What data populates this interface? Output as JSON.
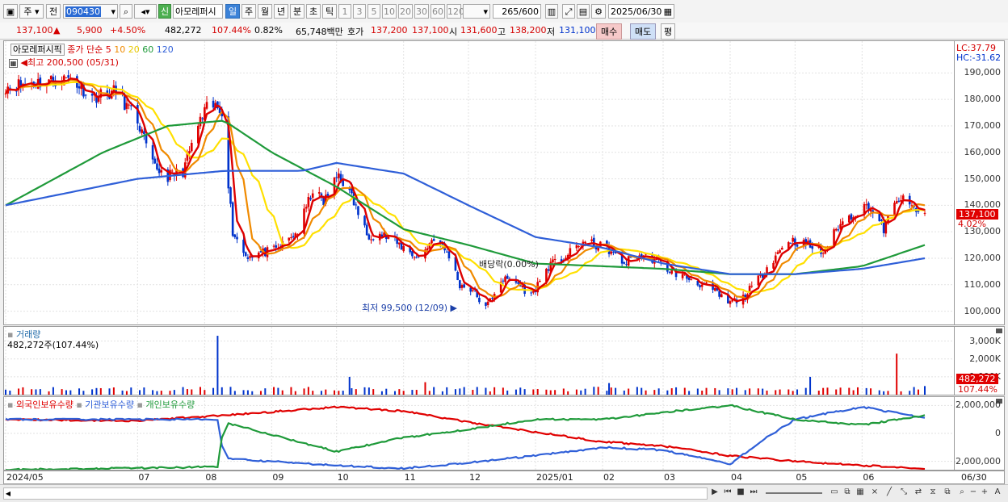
{
  "toolbar": {
    "type_label": "주",
    "prev_label": "전",
    "code": "090430",
    "sin_label": "신",
    "stock_name": "아모레퍼시",
    "periods": [
      "일",
      "주",
      "월",
      "년",
      "분",
      "초",
      "틱"
    ],
    "active_period": "일",
    "minutes": [
      "1",
      "3",
      "5",
      "10",
      "20",
      "30",
      "60",
      "120"
    ],
    "count": "265",
    "total": "/600",
    "date": "2025/06/30"
  },
  "quote": {
    "price": "137,100",
    "change": "5,900",
    "change_pct": "+4.50%",
    "volume": "482,272",
    "vol_ratio": "107.44%",
    "turnover": "0.82%",
    "amount": "65,748백만",
    "hoga_label": "호가",
    "ask": "137,200",
    "bid": "137,100",
    "open_label": "시",
    "open": "131,600",
    "high_label": "고",
    "high": "138,200",
    "low_label": "저",
    "low": "131,100",
    "buy_label": "매수",
    "sell_label": "매도",
    "avg_label": "평"
  },
  "legend": {
    "name": "아모레퍼시픽",
    "ma_prefix": "종가 단순",
    "ma5": "5",
    "ma10": "10",
    "ma20": "20",
    "ma60": "60",
    "ma120": "120",
    "lc": "LC:37.79",
    "hc": "HC:-31.62"
  },
  "annotations": {
    "high": "최고 200,500 (05/31)",
    "low": "최저 99,500 (12/09)",
    "dividend": "배당락(0.00%)"
  },
  "current_price_box": "137,100",
  "current_price_pct": "4.02%",
  "volume_panel": {
    "title": "거래량",
    "value_line": "482,272주(107.44%)",
    "box_value": "482,272",
    "box_pct": "107.44%"
  },
  "holdings_panel": {
    "foreign": "외국인보유수량",
    "inst": "기관보유수량",
    "indiv": "개인보유수량"
  },
  "colors": {
    "up": "#e00000",
    "down": "#0033cc",
    "ma5": "#dd0000",
    "ma10": "#f08a00",
    "ma20": "#ffe000",
    "ma60": "#1f9a3a",
    "ma120": "#2f5fd8"
  },
  "chart_data": {
    "type": "candlestick",
    "x_range": [
      "2024/05",
      "2025/06/30"
    ],
    "ylim": [
      95000,
      202000
    ],
    "price_ticks": [
      "190,000",
      "180,000",
      "170,000",
      "160,000",
      "150,000",
      "140,000",
      "130,000",
      "120,000",
      "110,000",
      "100,000"
    ],
    "x_ticks": [
      "2024/05",
      "07",
      "08",
      "09",
      "10",
      "11",
      "12",
      "2025/01",
      "02",
      "03",
      "04",
      "05",
      "06",
      "06/30"
    ],
    "price_path": [
      [
        "2024/05/01",
        185000
      ],
      [
        "2024/05/31",
        188000
      ],
      [
        "2024/06/10",
        181000
      ],
      [
        "2024/06/21",
        183000
      ],
      [
        "2024/07/01",
        172000
      ],
      [
        "2024/07/08",
        155000
      ],
      [
        "2024/07/15",
        151000
      ],
      [
        "2024/07/22",
        153000
      ],
      [
        "2024/07/29",
        170000
      ],
      [
        "2024/08/03",
        178000
      ],
      [
        "2024/08/09",
        176000
      ],
      [
        "2024/08/14",
        130000
      ],
      [
        "2024/08/20",
        121000
      ],
      [
        "2024/08/27",
        122000
      ],
      [
        "2024/09/03",
        123000
      ],
      [
        "2024/09/13",
        130000
      ],
      [
        "2024/09/20",
        146000
      ],
      [
        "2024/09/25",
        141000
      ],
      [
        "2024/10/02",
        152000
      ],
      [
        "2024/10/08",
        143000
      ],
      [
        "2024/10/15",
        129000
      ],
      [
        "2024/10/22",
        129000
      ],
      [
        "2024/11/01",
        124000
      ],
      [
        "2024/11/08",
        120000
      ],
      [
        "2024/11/15",
        128000
      ],
      [
        "2024/11/22",
        121000
      ],
      [
        "2024/11/27",
        110000
      ],
      [
        "2024/12/03",
        108000
      ],
      [
        "2024/12/09",
        101000
      ],
      [
        "2024/12/16",
        112000
      ],
      [
        "2024/12/23",
        111000
      ],
      [
        "2024/12/30",
        106000
      ],
      [
        "2025/01/07",
        117000
      ],
      [
        "2025/01/14",
        120000
      ],
      [
        "2025/01/23",
        126000
      ],
      [
        "2025/02/03",
        124000
      ],
      [
        "2025/02/10",
        118000
      ],
      [
        "2025/02/17",
        121000
      ],
      [
        "2025/02/24",
        120000
      ],
      [
        "2025/03/05",
        115000
      ],
      [
        "2025/03/14",
        112000
      ],
      [
        "2025/03/24",
        108000
      ],
      [
        "2025/03/31",
        103000
      ],
      [
        "2025/04/07",
        105000
      ],
      [
        "2025/04/14",
        112000
      ],
      [
        "2025/04/21",
        120000
      ],
      [
        "2025/04/28",
        127000
      ],
      [
        "2025/05/07",
        125000
      ],
      [
        "2025/05/14",
        122000
      ],
      [
        "2025/05/21",
        132000
      ],
      [
        "2025/05/28",
        137000
      ],
      [
        "2025/06/04",
        140000
      ],
      [
        "2025/06/11",
        131000
      ],
      [
        "2025/06/18",
        143000
      ],
      [
        "2025/06/24",
        139000
      ],
      [
        "2025/06/30",
        137100
      ]
    ],
    "ma60": [
      [
        "2024/05/01",
        140000
      ],
      [
        "2024/06/15",
        160000
      ],
      [
        "2024/07/15",
        170000
      ],
      [
        "2024/08/10",
        172000
      ],
      [
        "2024/09/01",
        160000
      ],
      [
        "2024/10/01",
        147000
      ],
      [
        "2024/11/01",
        131000
      ],
      [
        "2024/12/01",
        125000
      ],
      [
        "2025/01/01",
        118000
      ],
      [
        "2025/02/01",
        117000
      ],
      [
        "2025/03/01",
        116000
      ],
      [
        "2025/04/01",
        114000
      ],
      [
        "2025/05/01",
        114000
      ],
      [
        "2025/06/01",
        117000
      ],
      [
        "2025/06/30",
        125000
      ]
    ],
    "ma120": [
      [
        "2024/05/01",
        140000
      ],
      [
        "2024/07/01",
        150000
      ],
      [
        "2024/08/10",
        153000
      ],
      [
        "2024/09/15",
        153000
      ],
      [
        "2024/10/01",
        156000
      ],
      [
        "2024/11/01",
        152000
      ],
      [
        "2024/12/01",
        140000
      ],
      [
        "2025/01/01",
        128000
      ],
      [
        "2025/02/01",
        124000
      ],
      [
        "2025/03/01",
        118000
      ],
      [
        "2025/04/01",
        114000
      ],
      [
        "2025/05/01",
        114000
      ],
      [
        "2025/06/01",
        116000
      ],
      [
        "2025/06/30",
        120000
      ]
    ],
    "volume_ylim": [
      0,
      3800000
    ],
    "volume_ticks": [
      "3,000K",
      "2,000K",
      "1,000K"
    ],
    "volume_spikes": [
      [
        "2024/08/07",
        3300000
      ],
      [
        "2024/10/07",
        1000000
      ],
      [
        "2024/11/11",
        700000
      ],
      [
        "2025/02/04",
        650000
      ],
      [
        "2025/05/08",
        1000000
      ],
      [
        "2025/06/17",
        2300000
      ],
      [
        "2025/06/30",
        482272
      ]
    ],
    "holdings_ylim": [
      -2600000,
      2600000
    ],
    "holdings_ticks": [
      "2,000,000",
      "0",
      "-2,000,000"
    ],
    "series": [
      {
        "name": "외국인보유수량",
        "points": [
          [
            "2024/05/01",
            1000000
          ],
          [
            "2024/07/01",
            900000
          ],
          [
            "2024/08/20",
            1400000
          ],
          [
            "2024/10/01",
            1900000
          ],
          [
            "2024/11/01",
            1600000
          ],
          [
            "2024/12/01",
            800000
          ],
          [
            "2025/01/01",
            100000
          ],
          [
            "2025/02/01",
            -600000
          ],
          [
            "2025/03/01",
            -900000
          ],
          [
            "2025/04/01",
            -1600000
          ],
          [
            "2025/05/01",
            -2000000
          ],
          [
            "2025/06/01",
            -2300000
          ],
          [
            "2025/06/30",
            -2500000
          ]
        ]
      },
      {
        "name": "기관보유수량",
        "points": [
          [
            "2024/05/01",
            1000000
          ],
          [
            "2024/08/07",
            1000000
          ],
          [
            "2024/08/10",
            -1800000
          ],
          [
            "2024/10/01",
            -2300000
          ],
          [
            "2024/11/01",
            -2500000
          ],
          [
            "2024/12/01",
            -2100000
          ],
          [
            "2025/01/01",
            -1600000
          ],
          [
            "2025/02/01",
            -1000000
          ],
          [
            "2025/03/01",
            -1200000
          ],
          [
            "2025/04/01",
            -2200000
          ],
          [
            "2025/04/15",
            -600000
          ],
          [
            "2025/05/01",
            1000000
          ],
          [
            "2025/06/01",
            1900000
          ],
          [
            "2025/06/30",
            1100000
          ]
        ]
      },
      {
        "name": "개인보유수량",
        "points": [
          [
            "2024/05/01",
            -2600000
          ],
          [
            "2024/08/07",
            -2400000
          ],
          [
            "2024/08/10",
            800000
          ],
          [
            "2024/10/01",
            -1300000
          ],
          [
            "2024/11/01",
            -300000
          ],
          [
            "2024/12/01",
            300000
          ],
          [
            "2025/01/01",
            1000000
          ],
          [
            "2025/02/01",
            1000000
          ],
          [
            "2025/03/01",
            1500000
          ],
          [
            "2025/04/01",
            2000000
          ],
          [
            "2025/05/01",
            1000000
          ],
          [
            "2025/06/01",
            600000
          ],
          [
            "2025/06/30",
            1300000
          ]
        ]
      }
    ]
  }
}
